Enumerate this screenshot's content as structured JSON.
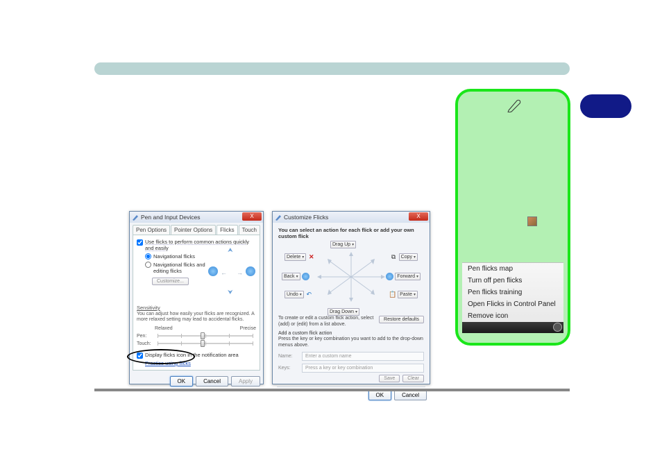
{
  "header": {},
  "green_panel": {
    "menu": {
      "items": [
        "Pen flicks map",
        "Turn off pen flicks",
        "Pen flicks training",
        "Open Flicks in Control Panel",
        "Remove icon"
      ]
    }
  },
  "dialog1": {
    "title": "Pen and Input Devices",
    "close": "X",
    "tabs": [
      "Pen Options",
      "Pointer Options",
      "Flicks",
      "Touch"
    ],
    "active_tab": "Flicks",
    "use_flicks_label": "Use flicks to perform common actions quickly and easily",
    "radio_nav": "Navigational flicks",
    "radio_nav_edit": "Navigational flicks and editing flicks",
    "customize_btn": "Customize...",
    "sensitivity_label": "Sensitivity",
    "sensitivity_desc": "You can adjust how easily your flicks are recognized. A more relaxed setting may lead to accidental flicks.",
    "relaxed": "Relaxed",
    "precise": "Precise",
    "pen_label": "Pen:",
    "touch_label": "Touch:",
    "display_icon_label": "Display flicks icon in the notification area",
    "practice_link": "Practice using flicks",
    "ok": "OK",
    "cancel": "Cancel",
    "apply": "Apply"
  },
  "dialog2": {
    "title": "Customize Flicks",
    "close": "X",
    "instruction": "You can select an action for each flick or add your own custom flick",
    "dd_top": "Drag Up",
    "dd_bottom": "Drag Down",
    "dd_left_top": "Delete",
    "dd_right_top": "Copy",
    "dd_left_mid": "Back",
    "dd_right_mid": "Forward",
    "dd_left_bot": "Undo",
    "dd_right_bot": "Paste",
    "create_desc": "To create or edit a custom flick action, select (add) or (edit) from a list above.",
    "add_custom_label": "Add a custom flick action",
    "add_custom_desc": "Press the key or key combination you want to add to the drop-down menus above.",
    "restore_btn": "Restore defaults",
    "name_label": "Name:",
    "name_placeholder": "Enter a custom name",
    "keys_label": "Keys:",
    "keys_placeholder": "Press a key or key combination",
    "save": "Save",
    "clear": "Clear",
    "ok": "OK",
    "cancel": "Cancel"
  }
}
